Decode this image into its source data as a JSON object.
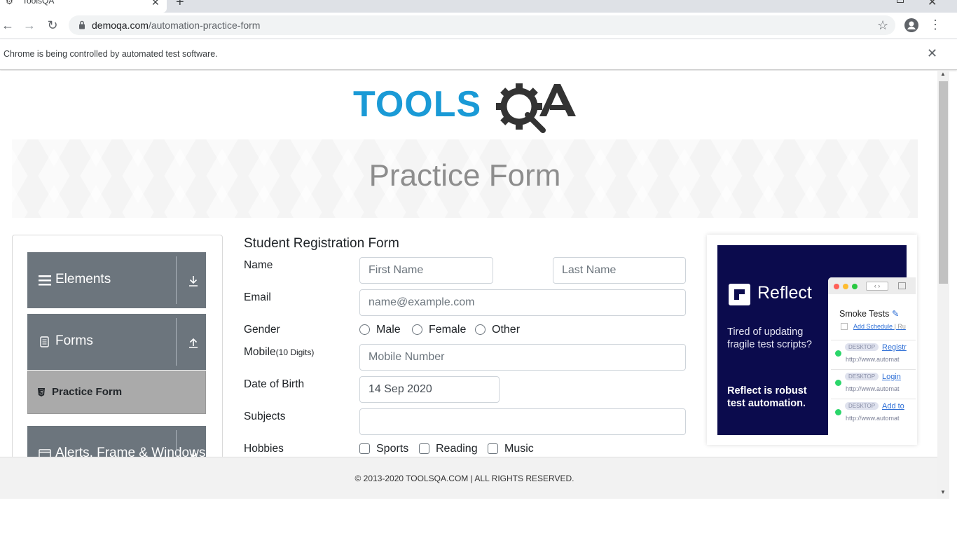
{
  "browser": {
    "tab_title": "ToolsQA",
    "url_host": "demoqa.com",
    "url_path": "/automation-practice-form",
    "infobar_text": "Chrome is being controlled by automated test software."
  },
  "banner": {
    "title": "Practice Form"
  },
  "sidebar": {
    "groups": [
      {
        "label": "Elements",
        "icon": "hamburger-icon",
        "arrow": "download-arrow-icon"
      },
      {
        "label": "Forms",
        "icon": "document-icon",
        "arrow": "upload-arrow-icon"
      },
      {
        "label": "Alerts, Frame & Windows",
        "icon": "window-icon",
        "arrow": "download-arrow-icon"
      }
    ],
    "active_item": {
      "label": "Practice Form",
      "icon": "html5-icon"
    }
  },
  "form": {
    "title": "Student Registration Form",
    "name_label": "Name",
    "first_name_placeholder": "First Name",
    "last_name_placeholder": "Last Name",
    "email_label": "Email",
    "email_placeholder": "name@example.com",
    "gender_label": "Gender",
    "gender_options": [
      "Male",
      "Female",
      "Other"
    ],
    "mobile_label": "Mobile",
    "mobile_hint": "(10 Digits)",
    "mobile_placeholder": "Mobile Number",
    "dob_label": "Date of Birth",
    "dob_value": "14 Sep 2020",
    "subjects_label": "Subjects",
    "subjects_value": "",
    "hobbies_label": "Hobbies",
    "hobbies_options": [
      "Sports",
      "Reading",
      "Music"
    ]
  },
  "ad": {
    "brand": "Reflect",
    "text1": "Tired of updating fragile test scripts?",
    "text2": "Reflect is robust test automation.",
    "window_title": "Smoke Tests",
    "schedule_link": "Add Schedule",
    "schedule_sep": "| Ru",
    "rows": [
      {
        "pill": "DESKTOP",
        "link": "Registr",
        "url": "http://www.automat"
      },
      {
        "pill": "DESKTOP",
        "link": "Login",
        "url": "http://www.automat"
      },
      {
        "pill": "DESKTOP",
        "link": "Add to",
        "url": "http://www.automat"
      }
    ]
  },
  "footer": {
    "text": "© 2013-2020 TOOLSQA.COM | ALL RIGHTS RESERVED."
  },
  "colors": {
    "brand_blue": "#1a9ad6",
    "brand_dark": "#333333",
    "sidebar_group": "#6c757d",
    "active_item": "#aaaaaa",
    "ad_bg": "#0b0b4d"
  }
}
